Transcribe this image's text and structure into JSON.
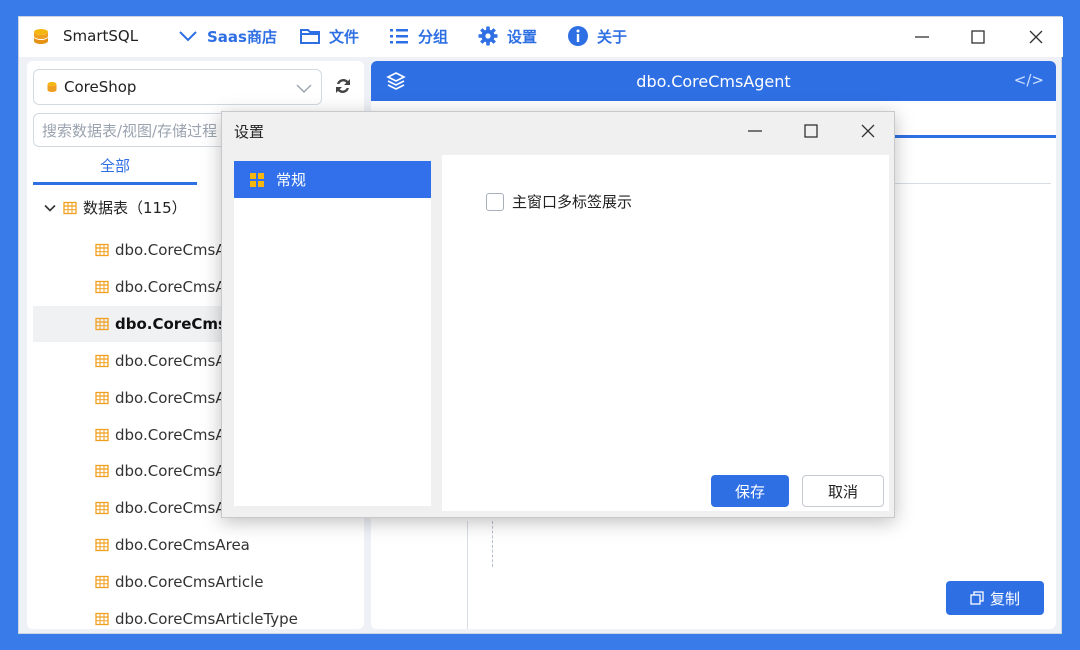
{
  "app": {
    "title": "SmartSQL",
    "menu": [
      {
        "label": "Saas商店",
        "icon": "chevron-down-icon"
      },
      {
        "label": "文件",
        "icon": "folder-icon"
      },
      {
        "label": "分组",
        "icon": "list-icon"
      },
      {
        "label": "设置",
        "icon": "gear-icon"
      },
      {
        "label": "关于",
        "icon": "info-icon"
      }
    ]
  },
  "sidebar": {
    "database": "CoreShop",
    "search_placeholder": "搜索数据表/视图/存储过程",
    "tab_all": "全部",
    "tree_root": "数据表（115）",
    "tables": [
      "dbo.CoreCmsA",
      "dbo.CoreCmsA",
      "dbo.CoreCmsA",
      "dbo.CoreCmsA",
      "dbo.CoreCmsA",
      "dbo.CoreCmsA",
      "dbo.CoreCmsA",
      "dbo.CoreCmsA",
      "dbo.CoreCmsArea",
      "dbo.CoreCmsArticle",
      "dbo.CoreCmsArticleType"
    ],
    "selected_index": 2
  },
  "main": {
    "tab_title": "dbo.CoreCmsAgent",
    "code_toggle": "</>",
    "copy_button": "复制"
  },
  "dialog": {
    "title": "设置",
    "nav_items": [
      "常规"
    ],
    "option_label": "主窗口多标签展示",
    "option_checked": false,
    "save_button": "保存",
    "cancel_button": "取消"
  },
  "colors": {
    "accent": "#2f6fe4",
    "background": "#3a7bea",
    "table_icon": "#f0a020"
  }
}
